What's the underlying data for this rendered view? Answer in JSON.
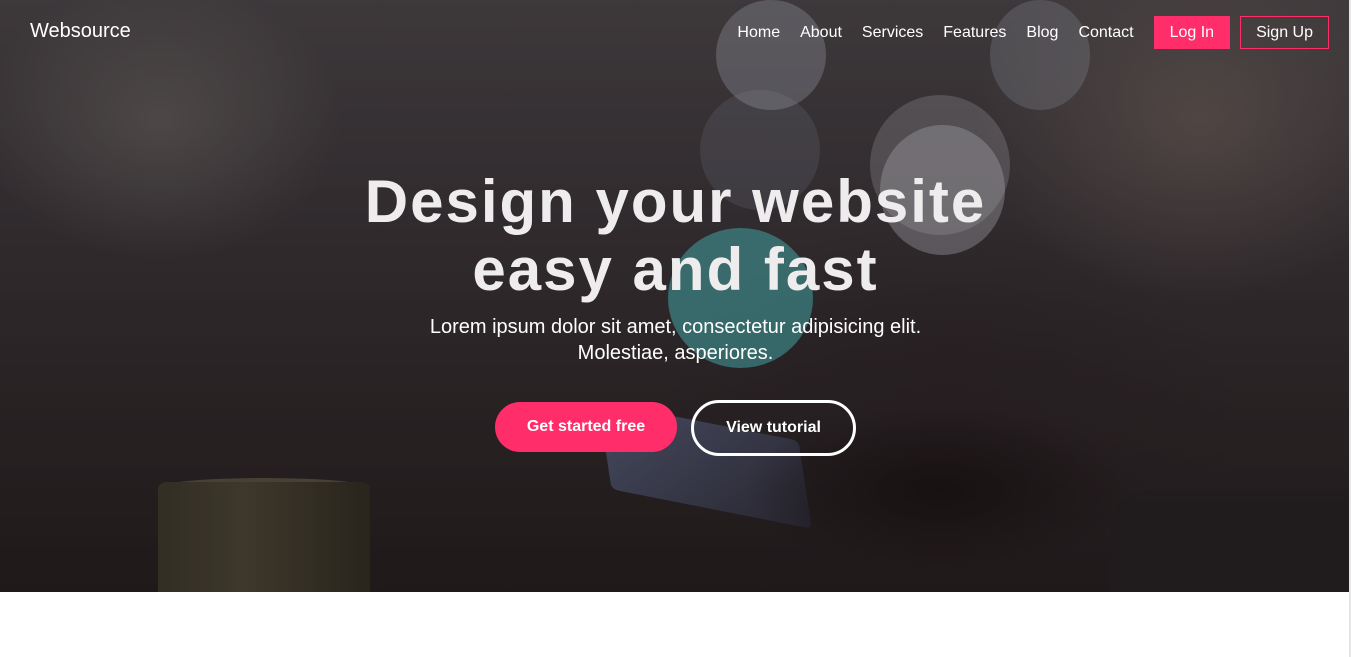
{
  "nav": {
    "brand": "Websource",
    "links": [
      "Home",
      "About",
      "Services",
      "Features",
      "Blog",
      "Contact"
    ],
    "login_label": "Log In",
    "signup_label": "Sign Up"
  },
  "hero": {
    "headline_line1": "Design your website",
    "headline_line2": "easy and fast",
    "subtext_line1": "Lorem ipsum dolor sit amet, consectetur adipisicing elit.",
    "subtext_line2": "Molestiae, asperiores.",
    "primary_cta": "Get started free",
    "secondary_cta": "View tutorial"
  },
  "colors": {
    "accent": "#ff2d6a",
    "text_light": "#ffffff",
    "background_below": "#ffffff"
  }
}
